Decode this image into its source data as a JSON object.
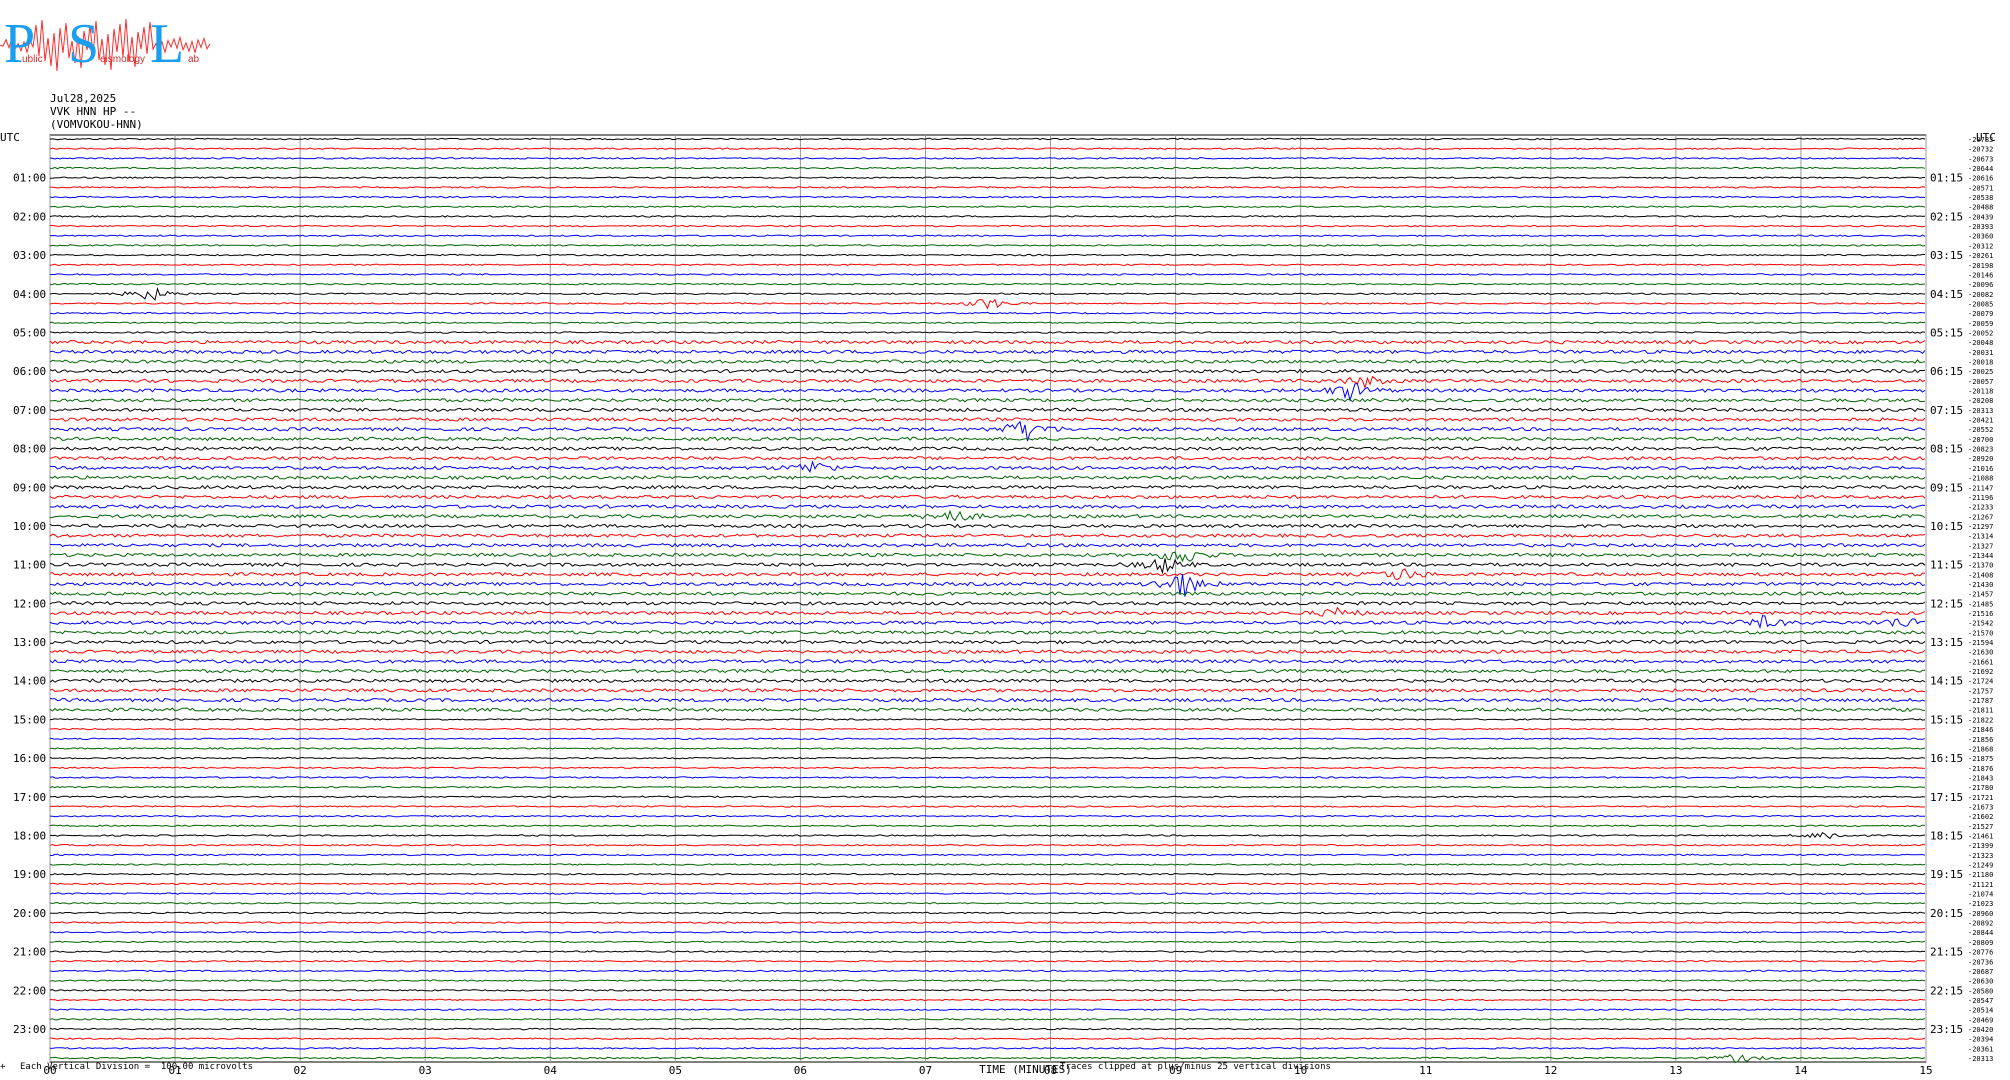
{
  "logo": {
    "letters": "PSL",
    "small_text": [
      "ublic",
      "eismology",
      "ab"
    ]
  },
  "header": {
    "date": "Jul28,2025",
    "station": "VVK HNN HP --",
    "location": "(VOMVOKOU-HNN)"
  },
  "footer": {
    "left_mark": "+",
    "scale_note": "Each Vertical Division =  100.00 microvolts",
    "xlabel": "TIME (MINUTES)",
    "clip_note": "Traces clipped at plus/minus 25 vertical divisions"
  },
  "chart_data": {
    "type": "line",
    "title": "",
    "xlabel": "TIME (MINUTES)",
    "ylabel": "UTC",
    "xlim": [
      0,
      15
    ],
    "x_ticks": [
      "00",
      "01",
      "02",
      "03",
      "04",
      "05",
      "06",
      "07",
      "08",
      "09",
      "10",
      "11",
      "12",
      "13",
      "14",
      "15"
    ],
    "left_axis_title": "UTC",
    "right_axis_title": "UTC",
    "left_labels": [
      "01:00",
      "02:00",
      "03:00",
      "04:00",
      "05:00",
      "06:00",
      "07:00",
      "08:00",
      "09:00",
      "10:00",
      "11:00",
      "12:00",
      "13:00",
      "14:00",
      "15:00",
      "16:00",
      "17:00",
      "18:00",
      "19:00",
      "20:00",
      "21:00",
      "22:00",
      "23:00"
    ],
    "right_labels": [
      "01:15",
      "02:15",
      "03:15",
      "04:15",
      "05:15",
      "06:15",
      "07:15",
      "08:15",
      "09:15",
      "10:15",
      "11:15",
      "12:15",
      "13:15",
      "14:15",
      "15:15",
      "16:15",
      "17:15",
      "18:15",
      "19:15",
      "20:15",
      "21:15",
      "22:15",
      "23:15"
    ],
    "trace_colors": [
      "#000000",
      "#ff0000",
      "#0000ff",
      "#006400"
    ],
    "num_traces": 96,
    "trace_offsets": [
      "-20783",
      "-20732",
      "-20673",
      "-20644",
      "-20616",
      "-20571",
      "-20538",
      "-20488",
      "-20439",
      "-20393",
      "-20360",
      "-20312",
      "-20261",
      "-20198",
      "-20146",
      "-20096",
      "-20082",
      "-20085",
      "-20079",
      "-20059",
      "-20052",
      "-20048",
      "-20031",
      "-20018",
      "-20025",
      "-20057",
      "-20118",
      "-20208",
      "-20313",
      "-20421",
      "-20552",
      "-20700",
      "-20823",
      "-20920",
      "-21016",
      "-21088",
      "-21147",
      "-21196",
      "-21233",
      "-21267",
      "-21297",
      "-21314",
      "-21327",
      "-21344",
      "-21370",
      "-21408",
      "-21430",
      "-21457",
      "-21485",
      "-21516",
      "-21542",
      "-21570",
      "-21594",
      "-21630",
      "-21661",
      "-21692",
      "-21724",
      "-21757",
      "-21787",
      "-21811",
      "-21822",
      "-21846",
      "-21856",
      "-21868",
      "-21875",
      "-21876",
      "-21843",
      "-21780",
      "-21721",
      "-21673",
      "-21602",
      "-21527",
      "-21461",
      "-21399",
      "-21323",
      "-21249",
      "-21180",
      "-21121",
      "-21074",
      "-21023",
      "-20960",
      "-20892",
      "-20844",
      "-20809",
      "-20776",
      "-20736",
      "-20687",
      "-20630",
      "-20580",
      "-20547",
      "-20514",
      "-20469",
      "-20420",
      "-20394",
      "-20361",
      "-20313"
    ],
    "events": [
      {
        "trace": 16,
        "minute": 0.8,
        "amp": 8
      },
      {
        "trace": 17,
        "minute": 7.5,
        "amp": 7
      },
      {
        "trace": 25,
        "minute": 10.5,
        "amp": 6
      },
      {
        "trace": 26,
        "minute": 10.4,
        "amp": 9
      },
      {
        "trace": 30,
        "minute": 7.8,
        "amp": 12
      },
      {
        "trace": 34,
        "minute": 6.1,
        "amp": 7
      },
      {
        "trace": 39,
        "minute": 7.2,
        "amp": 8
      },
      {
        "trace": 43,
        "minute": 9.05,
        "amp": 10
      },
      {
        "trace": 44,
        "minute": 8.9,
        "amp": 8
      },
      {
        "trace": 46,
        "minute": 9.05,
        "amp": 14
      },
      {
        "trace": 45,
        "minute": 10.8,
        "amp": 7
      },
      {
        "trace": 49,
        "minute": 10.3,
        "amp": 5
      },
      {
        "trace": 50,
        "minute": 13.7,
        "amp": 6
      },
      {
        "trace": 50,
        "minute": 14.8,
        "amp": 6
      },
      {
        "trace": 72,
        "minute": 14.2,
        "amp": 5
      },
      {
        "trace": 95,
        "minute": 13.5,
        "amp": 5
      }
    ]
  }
}
